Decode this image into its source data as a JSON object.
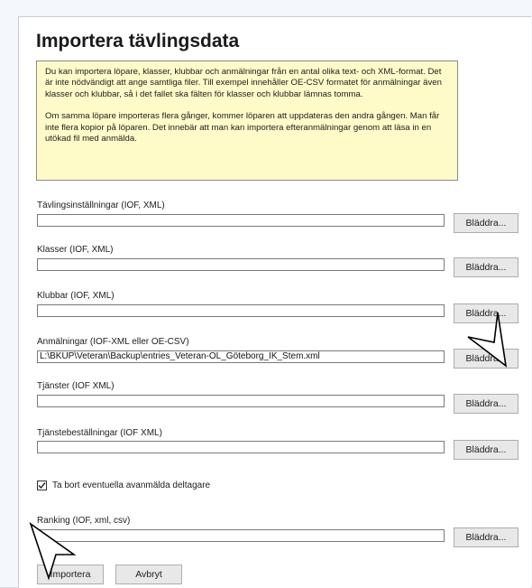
{
  "title": "Importera tävlingsdata",
  "info": {
    "paragraph1": "Du kan importera löpare, klasser, klubbar och anmälningar från en antal olika text- och XML-format. Det är inte nödvändigt att ange samtliga filer. Till exempel innehåller OE-CSV formatet för anmälningar även klasser och klubbar, så i det fallet ska fälten för klasser och klubbar lämnas tomma.",
    "paragraph2": "Om samma löpare importeras flera gånger, kommer löparen att uppdateras den andra gången. Man får inte flera kopior på löparen. Det innebär att man kan importera efteranmälningar genom att läsa in en utökad fil med anmälda."
  },
  "fields": [
    {
      "label": "Tävlingsinställningar (IOF, XML)",
      "value": "",
      "button": "Bläddra..."
    },
    {
      "label": "Klasser (IOF, XML)",
      "value": "",
      "button": "Bläddra..."
    },
    {
      "label": "Klubbar (IOF, XML)",
      "value": "",
      "button": "Bläddra..."
    },
    {
      "label": "Anmälningar (IOF-XML eller OE-CSV)",
      "value": "L:\\BKUP\\Veteran\\Backup\\entries_Veteran-OL_Göteborg_IK_Stem.xml",
      "button": "Bläddra..."
    },
    {
      "label": "Tjänster (IOF XML)",
      "value": "",
      "button": "Bläddra..."
    },
    {
      "label": "Tjänstebeställningar (IOF XML)",
      "value": "",
      "button": "Bläddra..."
    }
  ],
  "checkbox": {
    "label": "Ta bort eventuella avanmälda deltagare",
    "checked": true
  },
  "ranking": {
    "label": "Ranking (IOF, xml, csv)",
    "value": "",
    "button": "Bläddra..."
  },
  "actions": {
    "import": "Importera",
    "cancel": "Avbryt"
  }
}
